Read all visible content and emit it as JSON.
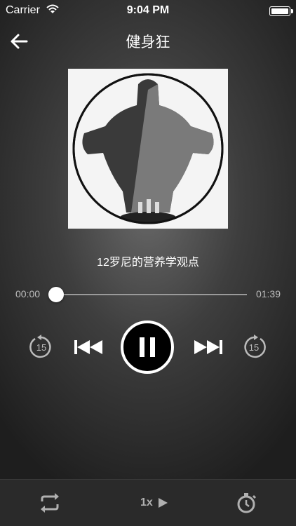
{
  "status_bar": {
    "carrier": "Carrier",
    "time": "9:04 PM"
  },
  "nav": {
    "title": "健身狂"
  },
  "track": {
    "title": "12罗尼的营养学观点"
  },
  "progress": {
    "elapsed": "00:00",
    "total": "01:39",
    "fraction": 0
  },
  "controls": {
    "skip_back_seconds": "15",
    "skip_forward_seconds": "15"
  },
  "bottom_bar": {
    "speed_label": "1x"
  },
  "icons": {
    "back": "back-arrow-icon",
    "rewind": "rewind-15-icon",
    "previous": "previous-track-icon",
    "pause": "pause-icon",
    "next": "next-track-icon",
    "forward": "forward-15-icon",
    "repeat": "repeat-icon",
    "speed": "play-speed-icon",
    "timer": "stopwatch-icon"
  },
  "colors": {
    "background": "#3e3e3e",
    "bottom_bar": "#2a2a2a",
    "accent": "#ffffff",
    "muted": "#bcbcbc"
  }
}
